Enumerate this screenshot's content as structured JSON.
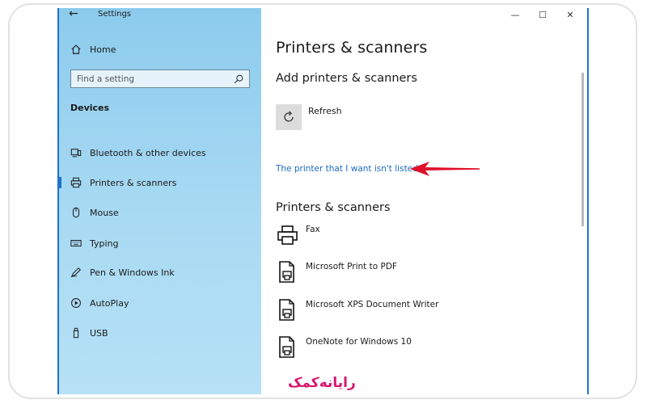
{
  "window": {
    "title": "Settings",
    "controls": {
      "minimize": "—",
      "maximize": "☐",
      "close": "✕"
    }
  },
  "sidebar": {
    "home_label": "Home",
    "search": {
      "placeholder": "Find a setting"
    },
    "section_label": "Devices",
    "items": [
      {
        "label": "Bluetooth & other devices",
        "icon": "bluetooth-devices-icon"
      },
      {
        "label": "Printers & scanners",
        "icon": "printer-icon",
        "active": true
      },
      {
        "label": "Mouse",
        "icon": "mouse-icon"
      },
      {
        "label": "Typing",
        "icon": "keyboard-icon"
      },
      {
        "label": "Pen & Windows Ink",
        "icon": "pen-icon"
      },
      {
        "label": "AutoPlay",
        "icon": "autoplay-icon"
      },
      {
        "label": "USB",
        "icon": "usb-icon"
      }
    ]
  },
  "main": {
    "page_title": "Printers & scanners",
    "add_section": {
      "heading": "Add printers & scanners",
      "refresh_label": "Refresh",
      "link_text": "The printer that I want isn't listed"
    },
    "printers_section": {
      "heading": "Printers & scanners",
      "printers": [
        {
          "name": "Fax",
          "icon": "fax-printer-icon"
        },
        {
          "name": "Microsoft Print to PDF",
          "icon": "document-printer-icon"
        },
        {
          "name": "Microsoft XPS Document Writer",
          "icon": "document-printer-icon"
        },
        {
          "name": "OneNote for Windows 10",
          "icon": "document-printer-icon"
        }
      ]
    }
  },
  "watermark": {
    "text": "رایانه‌کمک"
  },
  "colors": {
    "accent": "#1f74c8",
    "link": "#1a6bbf",
    "arrow": "#e0102a",
    "watermark": "#d8176f",
    "sidebar_top": "#8ccbed",
    "sidebar_bottom": "#b6e1f6"
  }
}
